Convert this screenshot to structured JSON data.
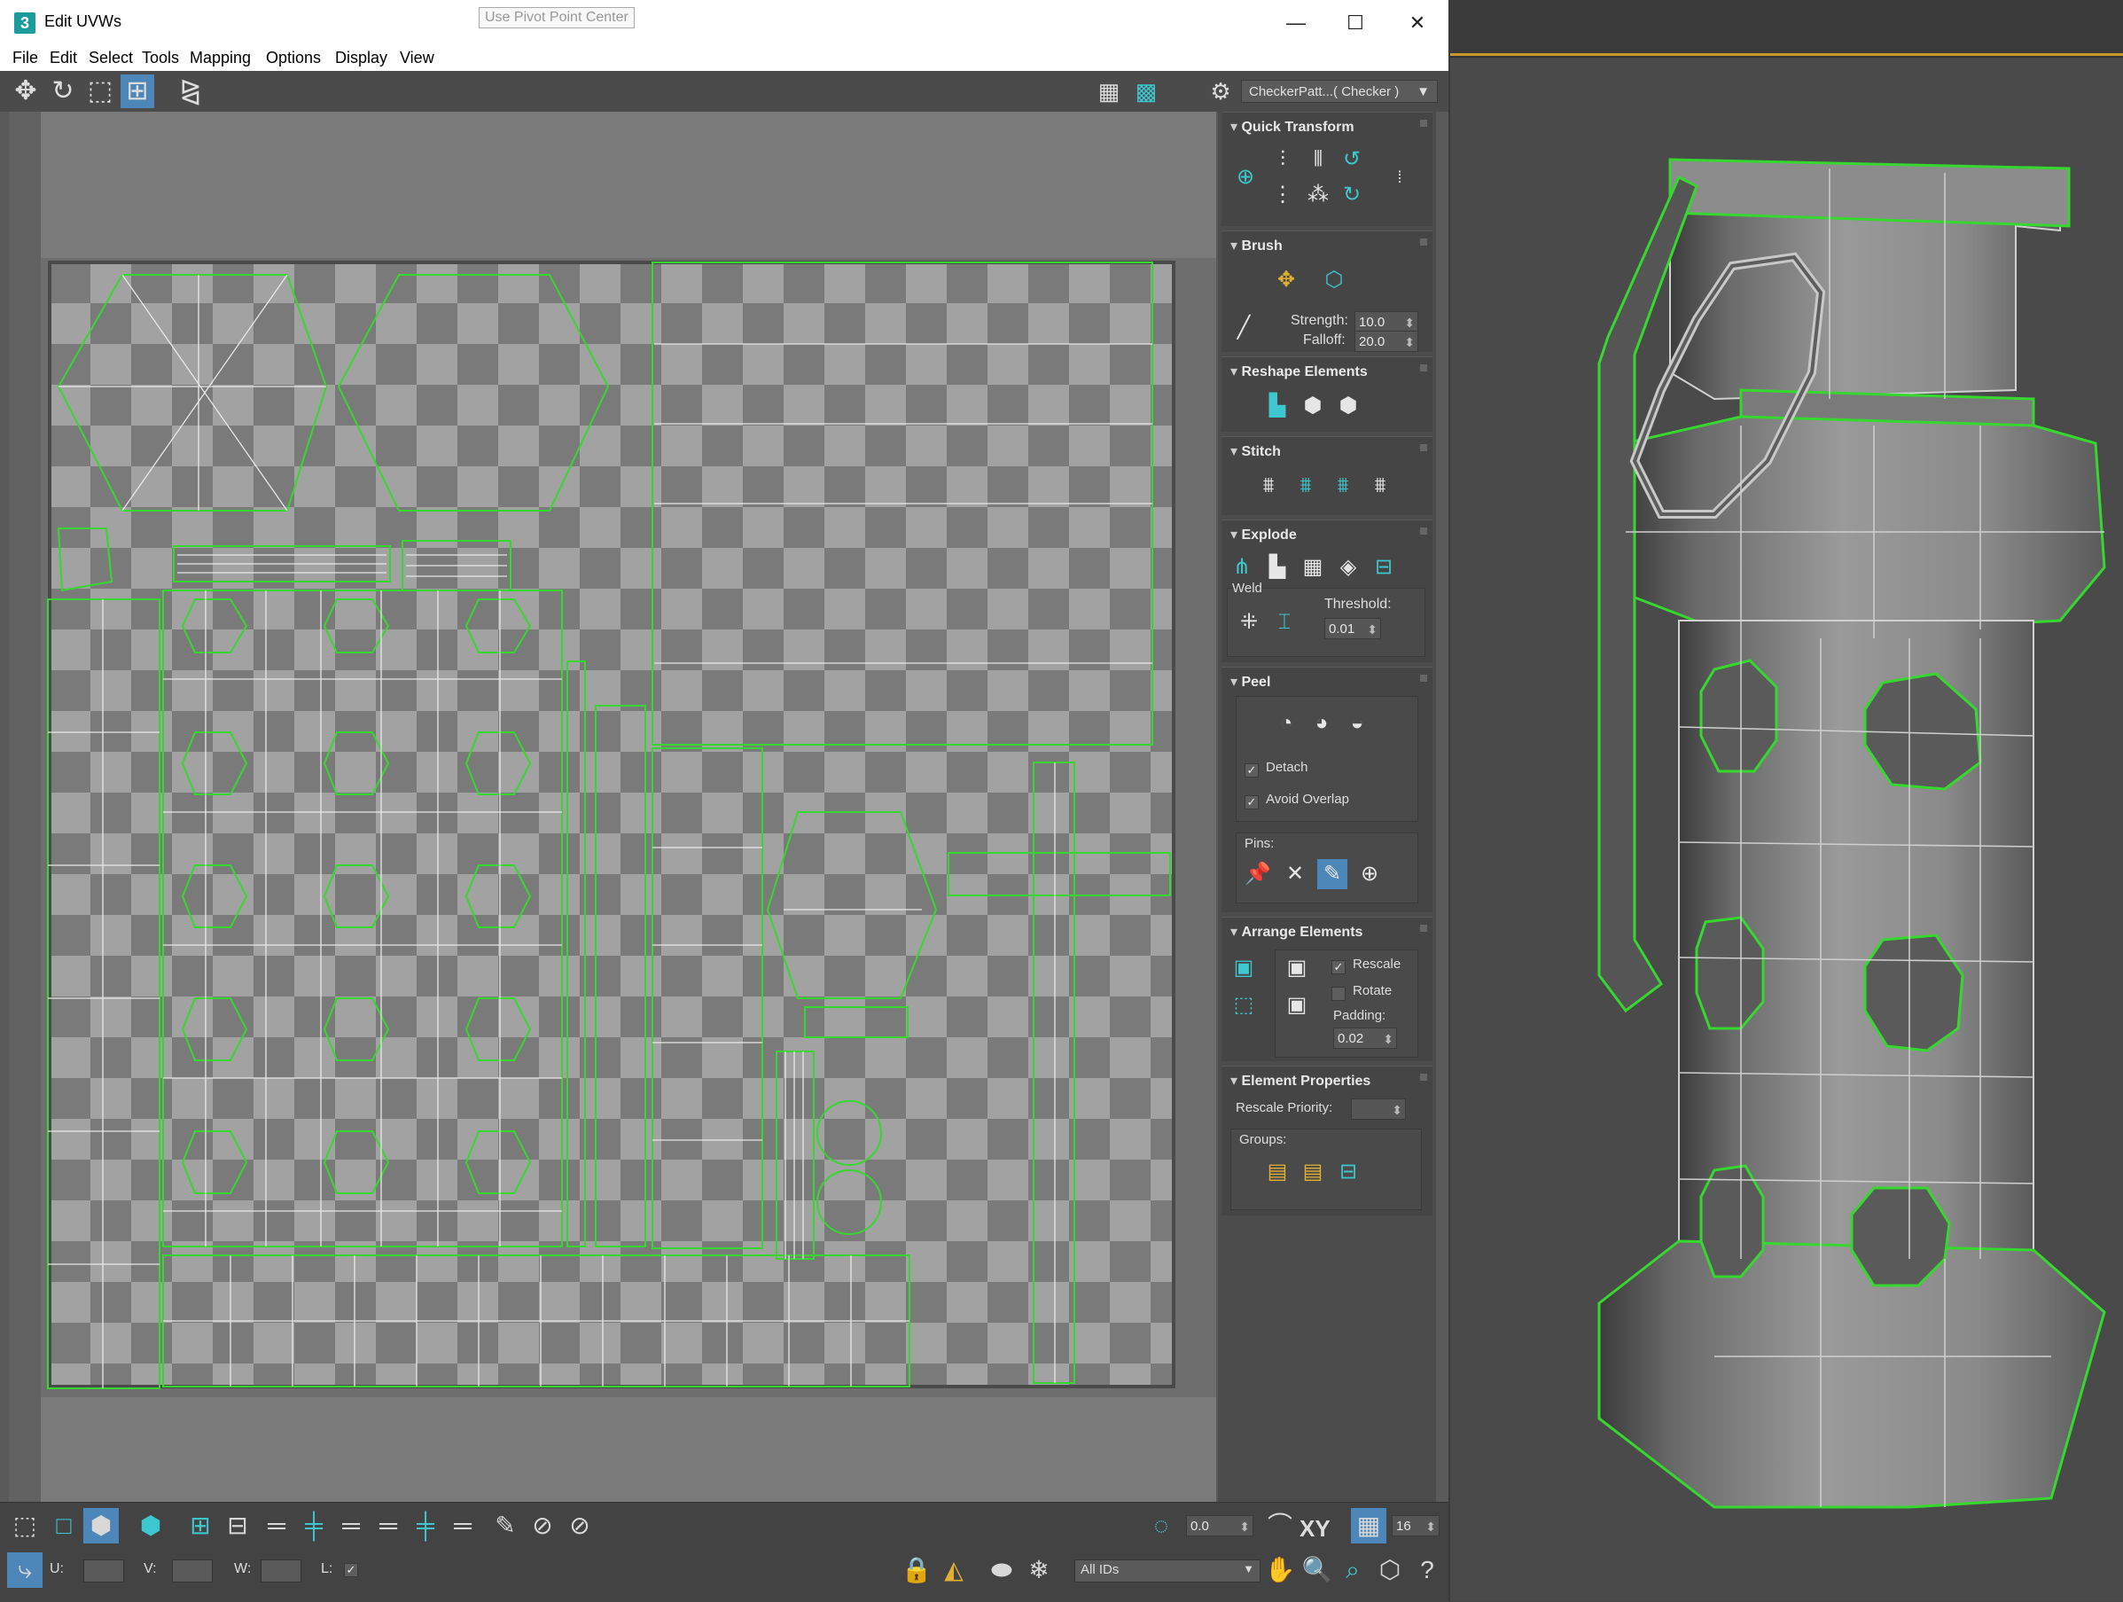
{
  "window": {
    "title": "Edit UVWs",
    "tooltip": "Use Pivot Point Center",
    "controls": {
      "minimize": "—",
      "maximize": "☐",
      "close": "✕"
    }
  },
  "menu": [
    "File",
    "Edit",
    "Select",
    "Tools",
    "Mapping",
    "Options",
    "Display",
    "View"
  ],
  "toolbar": {
    "uv_label": "U V",
    "checker_pattern": "CheckerPatt...( Checker )",
    "dropdown_arrow": "▼"
  },
  "panel": {
    "quick_transform": {
      "title": "Quick Transform"
    },
    "brush": {
      "title": "Brush",
      "strength_label": "Strength:",
      "strength_value": "10.0",
      "falloff_label": "Falloff:",
      "falloff_value": "20.0"
    },
    "reshape": {
      "title": "Reshape Elements"
    },
    "stitch": {
      "title": "Stitch"
    },
    "explode": {
      "title": "Explode",
      "weld_label": "Weld",
      "threshold_label": "Threshold:",
      "threshold_value": "0.01"
    },
    "peel": {
      "title": "Peel",
      "detach_label": "Detach",
      "avoid_overlap_label": "Avoid Overlap",
      "pins_label": "Pins:",
      "check": "✓"
    },
    "arrange": {
      "title": "Arrange Elements",
      "rescale_label": "Rescale",
      "rotate_label": "Rotate",
      "padding_label": "Padding:",
      "padding_value": "0.02",
      "check": "✓"
    },
    "element_props": {
      "title": "Element Properties",
      "rescale_priority_label": "Rescale Priority:",
      "groups_label": "Groups:"
    }
  },
  "bottom": {
    "rotation_value": "0.0",
    "xy_label": "XY",
    "grid_value": "16",
    "u_label": "U:",
    "v_label": "V:",
    "w_label": "W:",
    "l_label": "L:",
    "l_check": "✓",
    "ids_select": "All IDs"
  },
  "colors": {
    "accent_cyan": "#3ec7cf",
    "uv_edge_green": "#36d82f",
    "selection_blue": "#4d86b8",
    "viewport_bg": "#4a4a4a"
  }
}
